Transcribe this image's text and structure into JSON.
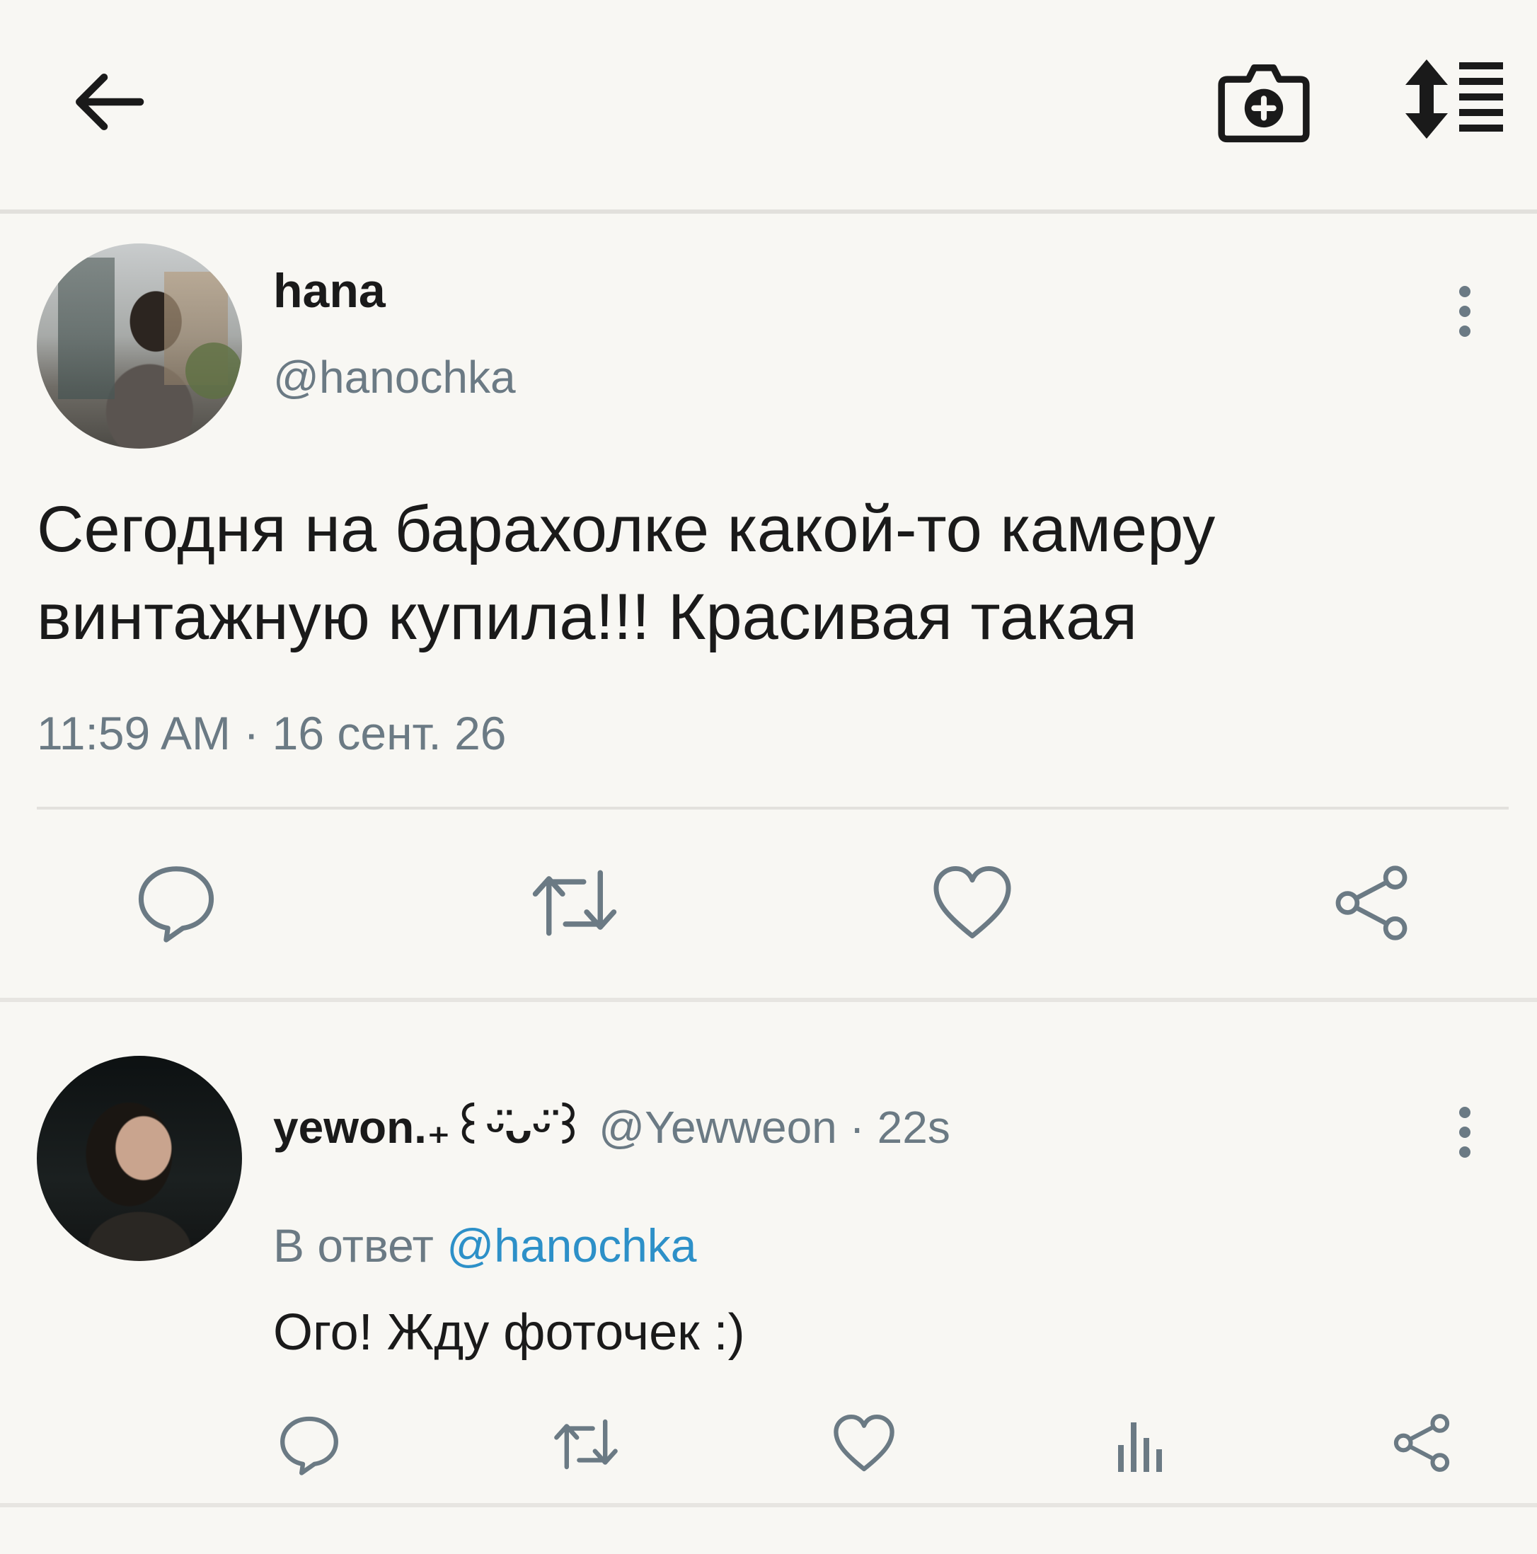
{
  "header": {
    "back_icon": "arrow-left-icon",
    "camera_icon": "camera-add-icon",
    "sort_icon": "sort-list-icon"
  },
  "tweet": {
    "author_name": "hana",
    "author_handle": "@hanochka",
    "text": "Сегодня на барахолке какой-то камеру винтажную купила!!! Красивая такая",
    "timestamp": "11:59 AM · 16 сент. 26",
    "actions": [
      "reply-icon",
      "retweet-icon",
      "heart-icon",
      "share-icon"
    ]
  },
  "reply": {
    "author_name": "yewon.₊꒰ᵕ̈ᴗᵕ̈꒱",
    "author_handle": "@Yewweon",
    "separator": " · ",
    "time": "22s",
    "in_reply_prefix": "В ответ ",
    "in_reply_mention": "@hanochka",
    "text": "Ого! Жду фоточек :)",
    "actions": [
      "reply-icon",
      "retweet-icon",
      "heart-icon",
      "stats-icon",
      "share-icon"
    ]
  },
  "colors": {
    "background": "#f8f7f3",
    "secondary_text": "#6b7a84",
    "mention": "#2d90c8",
    "divider": "#e3e1dd"
  }
}
